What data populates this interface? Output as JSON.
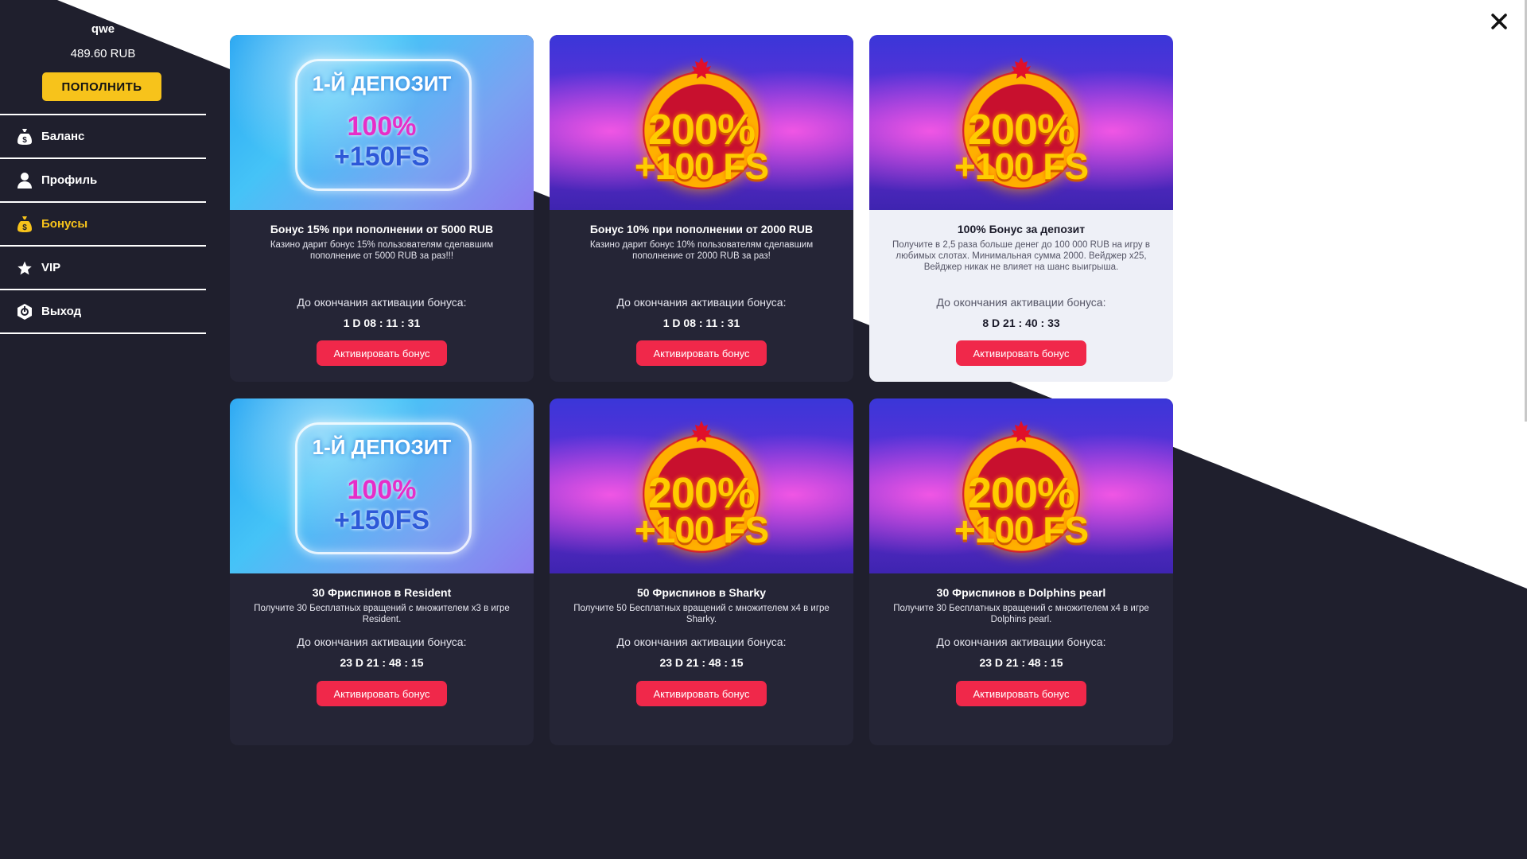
{
  "user": {
    "name": "qwe",
    "balance": "489.60 RUB",
    "deposit_label": "ПОПОЛНИТЬ"
  },
  "nav": [
    {
      "label": "Баланс",
      "icon": "money-bag-icon"
    },
    {
      "label": "Профиль",
      "icon": "user-icon"
    },
    {
      "label": "Бонусы",
      "icon": "bonus-bag-icon",
      "active": true
    },
    {
      "label": "VIP",
      "icon": "star-icon"
    },
    {
      "label": "Выход",
      "icon": "exit-icon"
    }
  ],
  "colors": {
    "accent_yellow": "#f7c31b",
    "button_red": "#f0284a",
    "dark_bg": "#1f1f2d",
    "card_bg": "#252536"
  },
  "common": {
    "timer_label": "До окончания активации бонуса:",
    "activate_label": "Активировать бонус"
  },
  "banners": {
    "deposit": {
      "title": "1-Й ДЕПОЗИТ",
      "percent": "100%",
      "fs": "+150FS"
    },
    "promo": {
      "percent": "200%",
      "fs": "+100 FS"
    }
  },
  "cards": [
    {
      "title": "Бонус 15% при пополнении от 5000 RUB",
      "desc": "Казино дарит бонус 15% пользователям сделавшим пополнение от 5000 RUB за раз!!!",
      "countdown": "1 D 08 : 11 : 31"
    },
    {
      "title": "Бонус 10% при пополнении от 2000 RUB",
      "desc": "Казино дарит бонус 10% пользователям сделавшим пополнение от 2000 RUB за раз!",
      "countdown": "1 D 08 : 11 : 31"
    },
    {
      "title": "100% Бонус за депозит",
      "desc": "Получите в 2,5 раза больше денег до 100 000 RUB на игру в любимых слотах. Минимальная сумма 2000. Вейджер x25, Вейджер никак не влияет на шанс выигрыша.",
      "countdown": "8 D 21 : 40 : 33"
    },
    {
      "title": "30 Фриспинов в Resident",
      "desc": "Получите 30 Бесплатных вращений с множителем x3 в игре Resident.",
      "countdown": "23 D 21 : 48 : 15"
    },
    {
      "title": "50 Фриспинов в Sharky",
      "desc": "Получите 50 Бесплатных вращений с множителем x4 в игре Sharky.",
      "countdown": "23 D 21 : 48 : 15"
    },
    {
      "title": "30 Фриспинов в Dolphins pearl",
      "desc": "Получите 30 Бесплатных вращений с множителем x4 в игре Dolphins pearl.",
      "countdown": "23 D 21 : 48 : 15"
    }
  ]
}
